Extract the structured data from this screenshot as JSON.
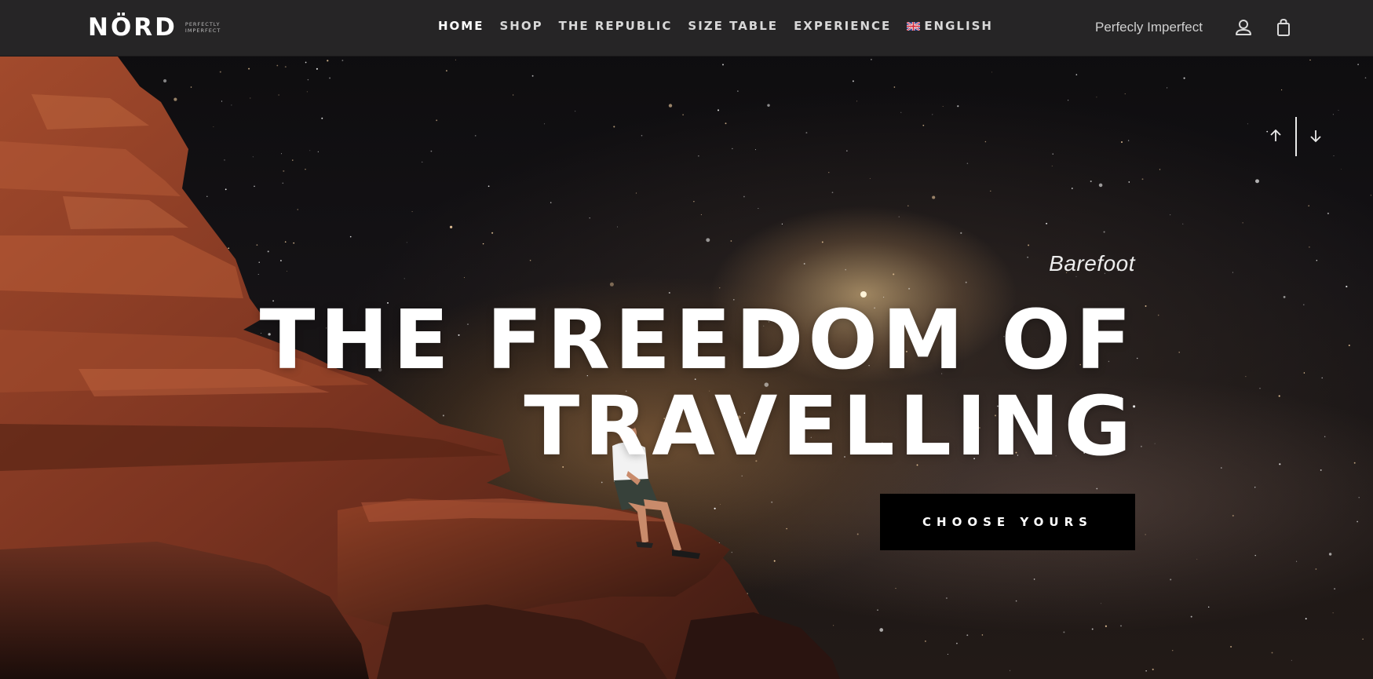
{
  "brand": {
    "name": "NÖRD",
    "tagline": "PERFECTLY IMPERFECT"
  },
  "nav": {
    "items": [
      {
        "label": "HOME",
        "active": true
      },
      {
        "label": "SHOP",
        "active": false
      },
      {
        "label": "THE REPUBLIC",
        "active": false
      },
      {
        "label": "SIZE TABLE",
        "active": false
      },
      {
        "label": "EXPERIENCE",
        "active": false
      },
      {
        "label": "ENGLISH",
        "active": false,
        "icon": "uk-flag-icon"
      }
    ]
  },
  "header": {
    "right_text": "Perfecly Imperfect",
    "icons": [
      "account-icon",
      "shopping-bag-icon"
    ]
  },
  "slider": {
    "controls": [
      "arrow-up-icon",
      "arrow-down-icon"
    ]
  },
  "hero": {
    "subtitle": "Barefoot",
    "headline_line1": "THE FREEDOM OF",
    "headline_line2": "TRAVELLING",
    "cta_label": "CHOOSE YOURS"
  },
  "colors": {
    "header_bg": "#262526",
    "cta_bg": "#000000",
    "text": "#ffffff",
    "rock": "#8a3c22"
  }
}
